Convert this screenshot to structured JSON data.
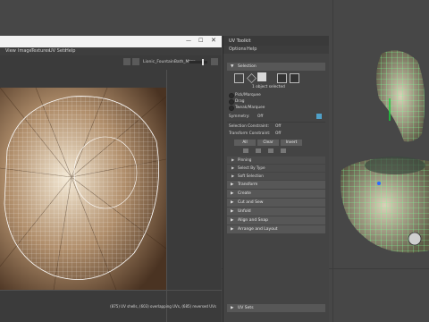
{
  "uv_editor": {
    "menu": [
      "View",
      "Image",
      "Textures",
      "UV Sets",
      "Help"
    ],
    "uv_set": "Lionic_FountainBath_Mtgn",
    "status": "(875) UV shells, (603) overlapping UVs, (685) reversed UVs"
  },
  "toolkit": {
    "title": "UV Toolkit",
    "menu": [
      "Options",
      "Help"
    ],
    "selection_header": "Selection",
    "selected_count": "1 object selected",
    "radio_options": [
      "Pick/Marquee",
      "Drag",
      "Tweak/Marquee"
    ],
    "symmetry_label": "Symmetry:",
    "symmetry_value": "Off",
    "selection_constraint_label": "Selection Constraint:",
    "selection_constraint_value": "Off",
    "transform_constraint_label": "Transform Constraint:",
    "transform_constraint_value": "Off",
    "buttons": [
      "All",
      "Clear",
      "Invert"
    ],
    "sub_sections": [
      "Pinning",
      "Select By Type",
      "Soft Selection"
    ],
    "sections": [
      "Transform",
      "Create",
      "Cut and Sew",
      "Unfold",
      "Align and Snap",
      "Arrange and Layout"
    ],
    "footer_section": "UV Sets"
  },
  "colors": {
    "viewport": "#474747",
    "panel": "#444444",
    "section": "#575757",
    "wire": "#7dff9a"
  }
}
